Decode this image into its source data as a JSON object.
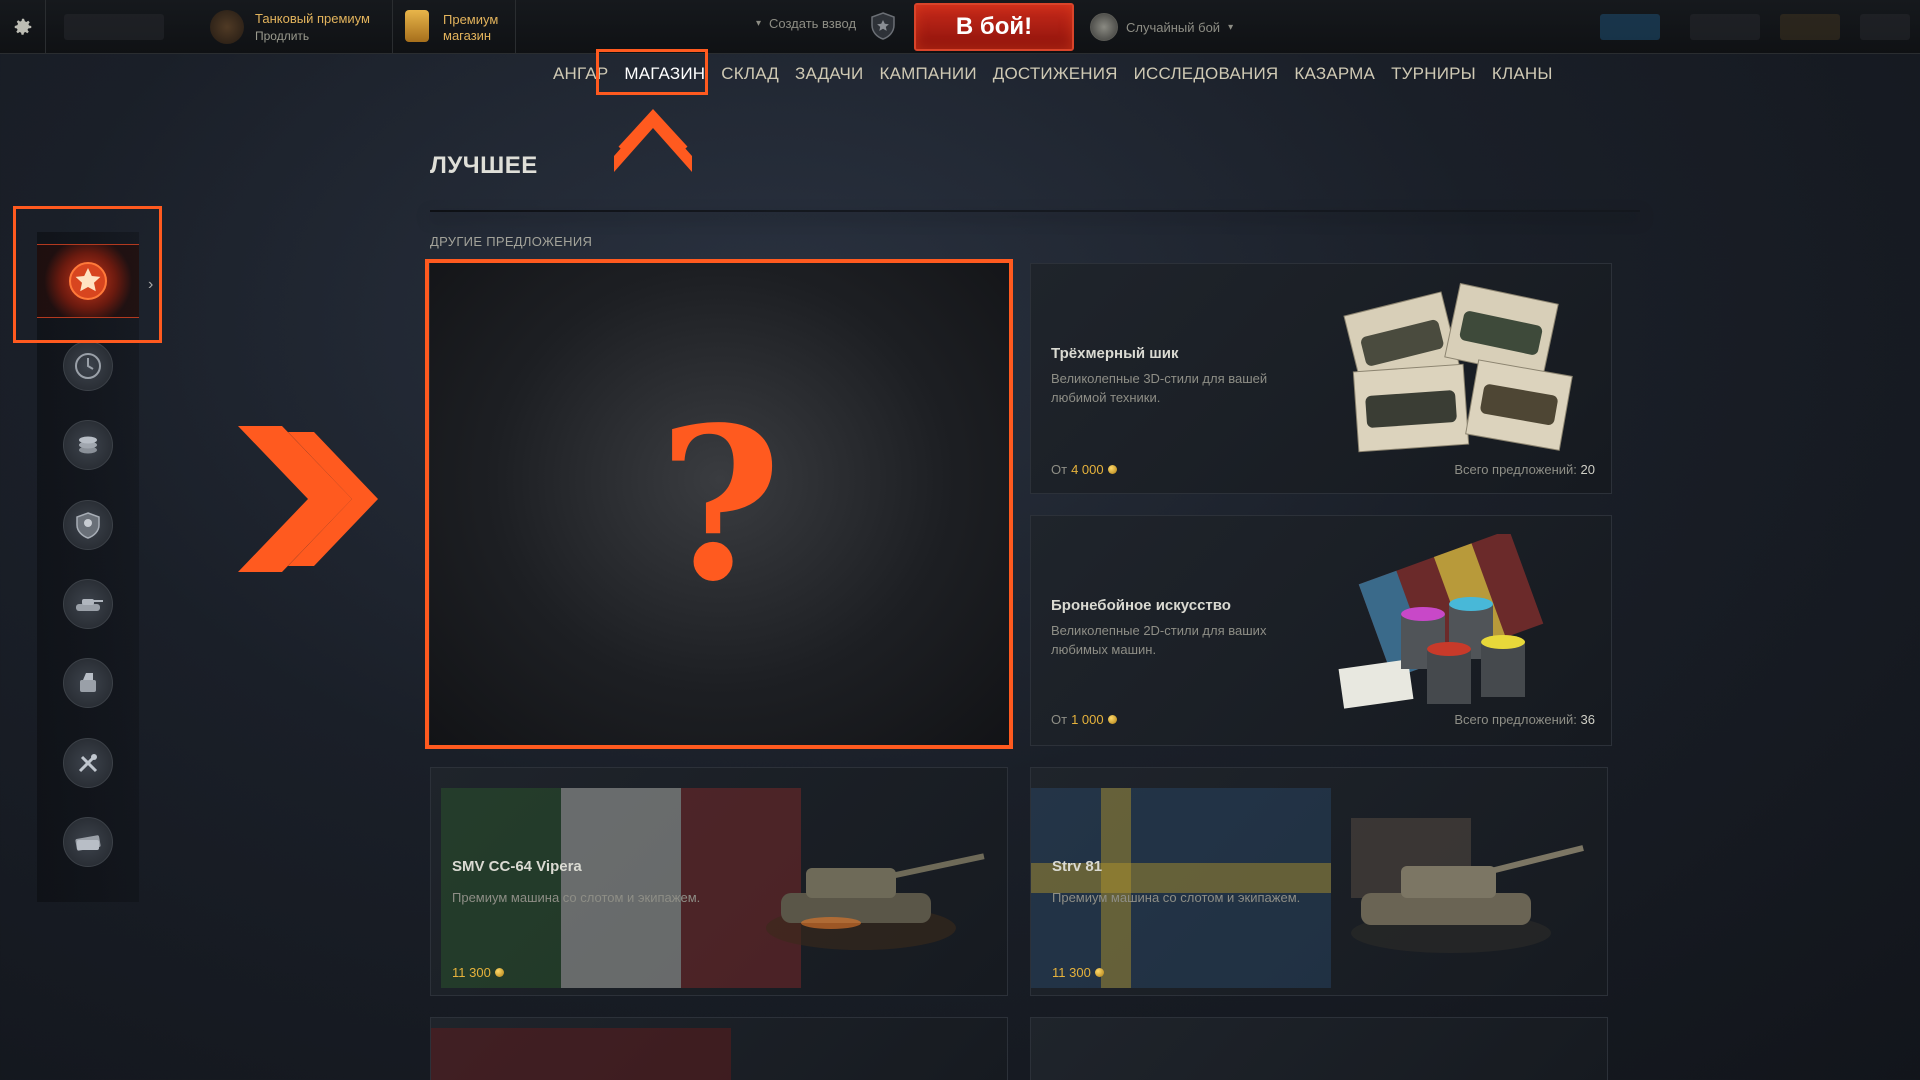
{
  "topbar": {
    "tank_premium_title": "Танковый премиум",
    "tank_premium_action": "Продлить",
    "premium_shop_line1": "Премиум",
    "premium_shop_line2": "магазин",
    "create_platoon": "Создать взвод",
    "battle_button": "В бой!",
    "battle_mode": "Случайный бой"
  },
  "nav": {
    "items": [
      "АНГАР",
      "МАГАЗИН",
      "СКЛАД",
      "ЗАДАЧИ",
      "КАМПАНИИ",
      "ДОСТИЖЕНИЯ",
      "ИССЛЕДОВАНИЯ",
      "КАЗАРМА",
      "ТУРНИРЫ",
      "КЛАНЫ"
    ],
    "active": "МАГАЗИН"
  },
  "page": {
    "title": "ЛУЧШЕЕ",
    "section_label": "ДРУГИЕ ПРЕДЛОЖЕНИЯ"
  },
  "sidebar": {
    "icons": [
      "star-icon",
      "clock-icon",
      "coins-icon",
      "crew-shield-icon",
      "tank-icon",
      "equipment-icon",
      "tools-icon",
      "money-icon"
    ]
  },
  "mystery": {
    "symbol": "?"
  },
  "cards": [
    {
      "title": "Трёхмерный шик",
      "desc": "Великолепные 3D-стили для вашей любимой техники.",
      "price_prefix": "От",
      "price": "4 000",
      "total_label": "Всего предложений:",
      "total": "20"
    },
    {
      "title": "Бронебойное искусство",
      "desc": "Великолепные 2D-стили для ваших любимых машин.",
      "price_prefix": "От",
      "price": "1 000",
      "total_label": "Всего предложений:",
      "total": "36"
    },
    {
      "title": "SMV CC-64 Vipera",
      "desc": "Премиум машина со слотом и экипажем.",
      "price": "11 300"
    },
    {
      "title": "Strv 81",
      "desc": "Премиум машина со слотом и экипажем.",
      "price": "11 300"
    }
  ],
  "colors": {
    "accent": "#ff5a1f",
    "gold": "#e6b23c",
    "battle_button": "#c82a1a"
  }
}
